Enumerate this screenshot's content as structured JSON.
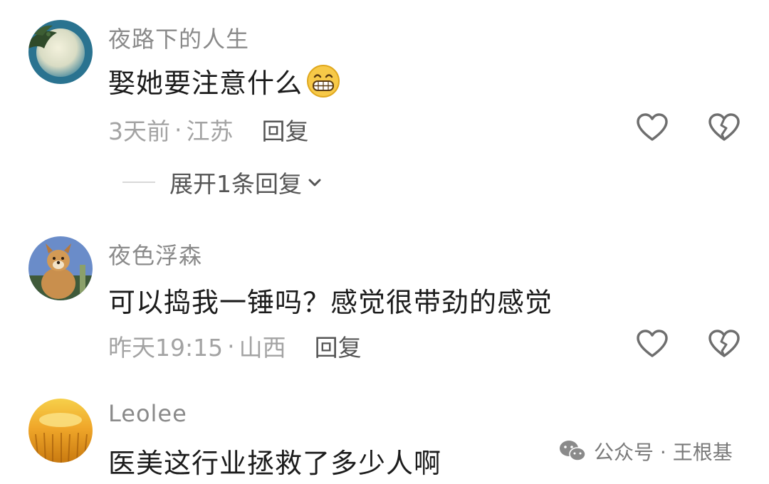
{
  "comments": [
    {
      "username": "夜路下的人生",
      "text": "娶她要注意什么",
      "emoji": "grinning-face",
      "time": "3天前",
      "location": "江苏",
      "reply_label": "回复",
      "expand_label": "展开1条回复"
    },
    {
      "username": "夜色浮森",
      "text": "可以捣我一锤吗？感觉很带劲的感觉",
      "time": "昨天19:15",
      "location": "山西",
      "reply_label": "回复"
    },
    {
      "username": "Leolee",
      "text": "医美这行业拯救了多少人啊"
    }
  ],
  "watermark": {
    "label": "公众号 · 王根基"
  },
  "colors": {
    "username": "#8a8a8a",
    "meta": "#a3a3a3",
    "text": "#1c1c1c",
    "icon": "#6e6e6e"
  }
}
